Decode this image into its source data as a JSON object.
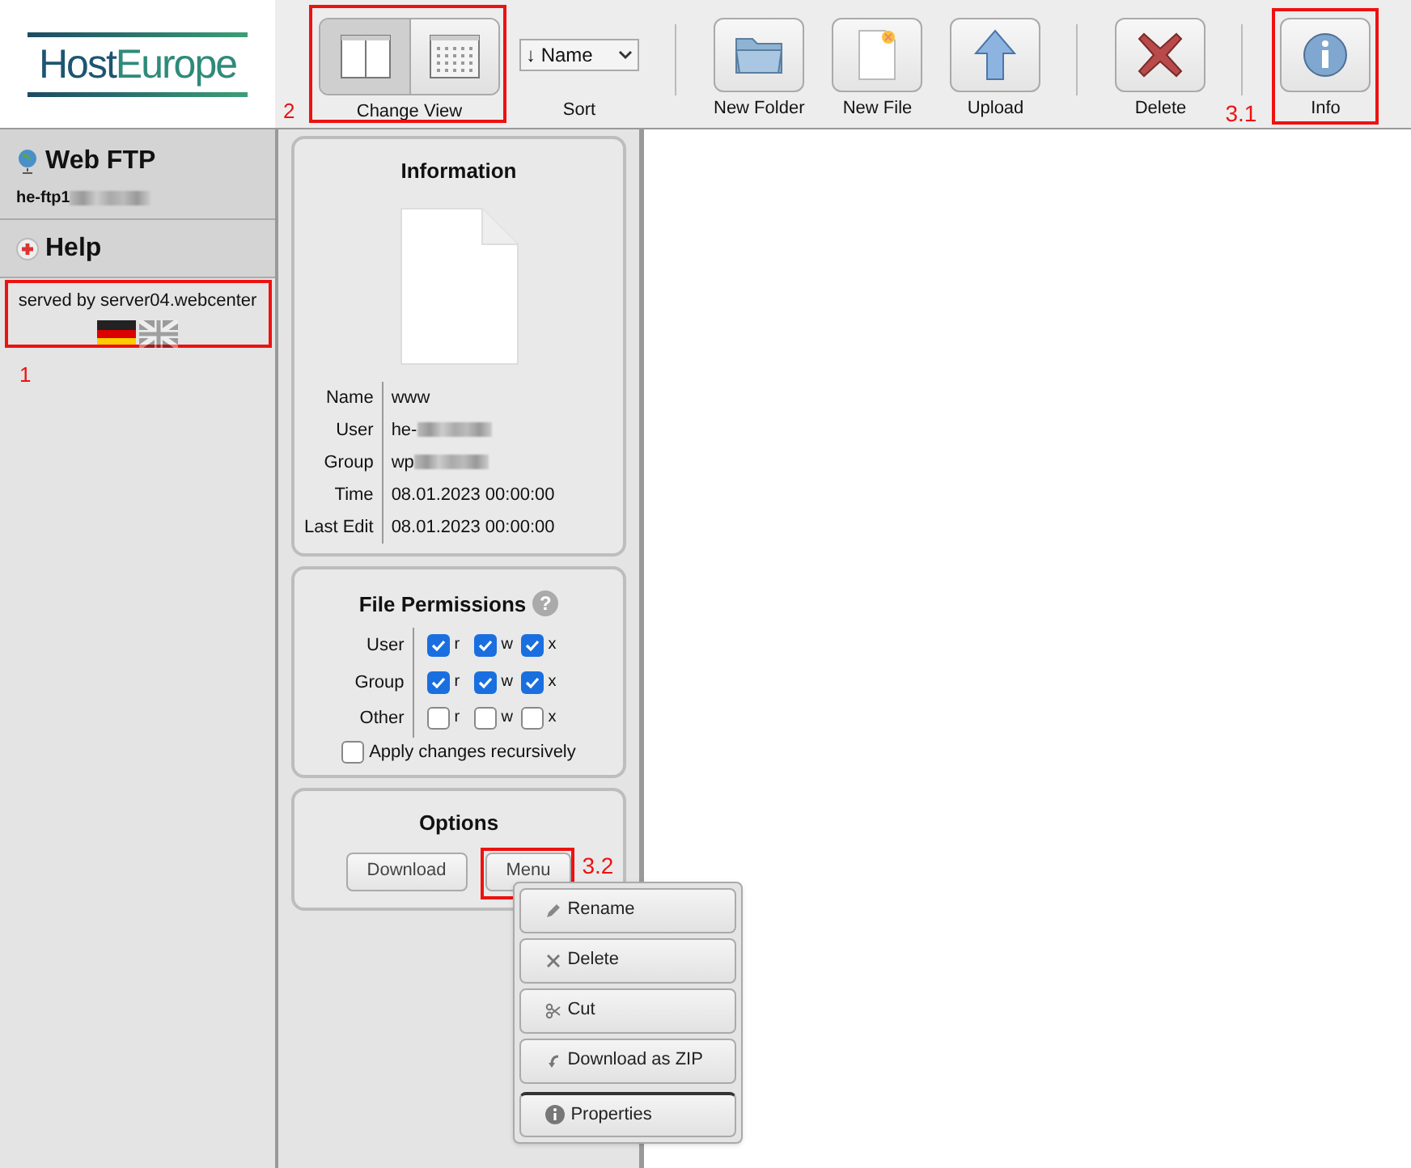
{
  "logo": {
    "parts": [
      "Host",
      "Europe"
    ]
  },
  "toolbar": {
    "view": {
      "label": "Change View",
      "annotation": "2",
      "buttons": [
        {
          "kind": "split",
          "selected": true
        },
        {
          "kind": "grid",
          "selected": false
        }
      ]
    },
    "sort": {
      "value": "↓ Name",
      "label": "Sort"
    },
    "action_groups": [
      [
        {
          "kind": "folder",
          "label": "New Folder"
        },
        {
          "kind": "file",
          "label": "New File"
        },
        {
          "kind": "upload",
          "label": "Upload"
        }
      ],
      [
        {
          "kind": "delete",
          "label": "Delete"
        }
      ],
      [
        {
          "kind": "info",
          "label": "Info",
          "annotation": "3.1"
        }
      ]
    ]
  },
  "sidebar": {
    "title": "Web FTP",
    "host": "he-ftp1",
    "host_redacted": true,
    "help": "Help",
    "served": "served by server04.webcenter",
    "annotation": "1",
    "languages": [
      {
        "kind": "de",
        "selected": true
      },
      {
        "kind": "uk",
        "selected": false
      }
    ]
  },
  "information": {
    "title": "Information",
    "rows": [
      {
        "label": "Name",
        "value": "www",
        "redacted": false
      },
      {
        "label": "User",
        "value": "he-",
        "redacted": true
      },
      {
        "label": "Group",
        "value": "wp",
        "redacted": true
      },
      {
        "label": "Time",
        "value": "08.01.2023 00:00:00",
        "redacted": false
      },
      {
        "label": "Last Edit",
        "value": "08.01.2023 00:00:00",
        "redacted": false
      }
    ]
  },
  "permissions": {
    "title": "File Permissions",
    "help": "?",
    "rows": [
      {
        "label": "User",
        "perms": [
          {
            "letter": "r",
            "checked": true
          },
          {
            "letter": "w",
            "checked": true
          },
          {
            "letter": "x",
            "checked": true
          }
        ]
      },
      {
        "label": "Group",
        "perms": [
          {
            "letter": "r",
            "checked": true
          },
          {
            "letter": "w",
            "checked": true
          },
          {
            "letter": "x",
            "checked": true
          }
        ]
      },
      {
        "label": "Other",
        "perms": [
          {
            "letter": "r",
            "checked": false
          },
          {
            "letter": "w",
            "checked": false
          },
          {
            "letter": "x",
            "checked": false
          }
        ]
      }
    ],
    "recursive": {
      "label": "Apply changes recursively",
      "checked": false
    }
  },
  "options": {
    "title": "Options",
    "download": "Download",
    "menu": "Menu",
    "annotation": "3.2"
  },
  "menu": {
    "items": [
      {
        "kind": "pencil",
        "label": "Rename",
        "separator_before": false
      },
      {
        "kind": "cross",
        "label": "Delete",
        "separator_before": false
      },
      {
        "kind": "scissors",
        "label": "Cut",
        "separator_before": false
      },
      {
        "kind": "download",
        "label": "Download as ZIP",
        "separator_before": false
      },
      {
        "kind": "info",
        "label": "Properties",
        "separator_before": true
      }
    ]
  }
}
